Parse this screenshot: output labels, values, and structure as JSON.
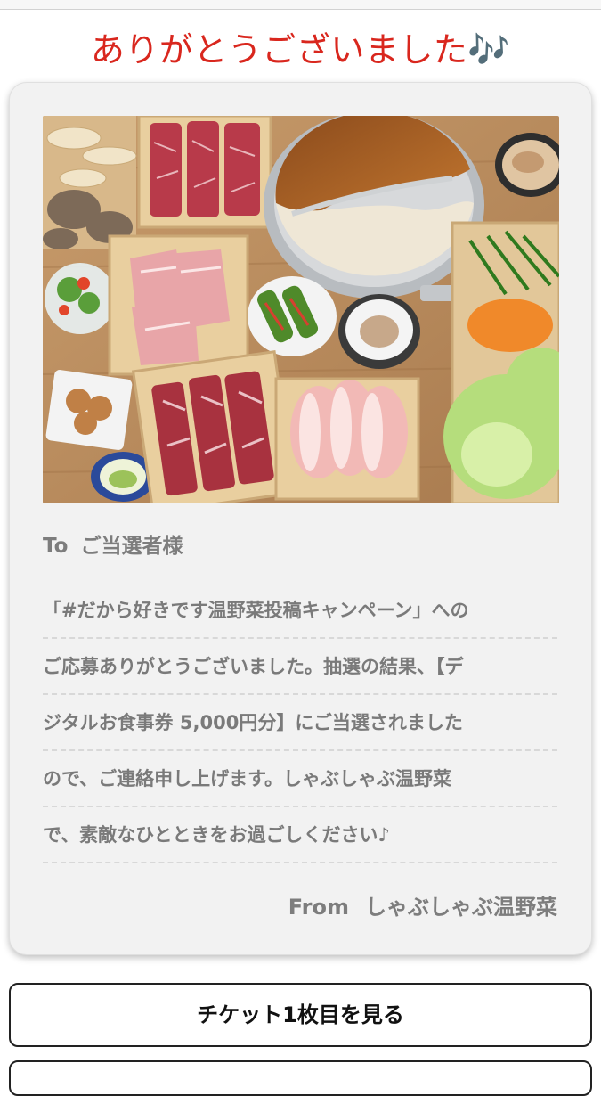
{
  "header": {
    "title": "ありがとうございました🎶"
  },
  "card": {
    "photo_alt": "しゃぶしゃぶ温野菜",
    "to_label": "To",
    "to_name": "ご当選者様",
    "message_lines": [
      "「#だから好きです温野菜投稿キャンペーン」への",
      "ご応募ありがとうございました。抽選の結果、【デ",
      "ジタルお食事券 5,000円分】にご当選されました",
      "ので、ご連絡申し上げます。しゃぶしゃぶ温野菜",
      "で、素敵なひとときをお過ごしください♪"
    ],
    "from_label": "From",
    "from_name": "しゃぶしゃぶ温野菜"
  },
  "buttons": {
    "ticket_label": "チケット1枚目を見る"
  },
  "colors": {
    "headline": "#d9271e",
    "card_background": "#f2f2f2",
    "body_text": "#7a7a7a"
  }
}
